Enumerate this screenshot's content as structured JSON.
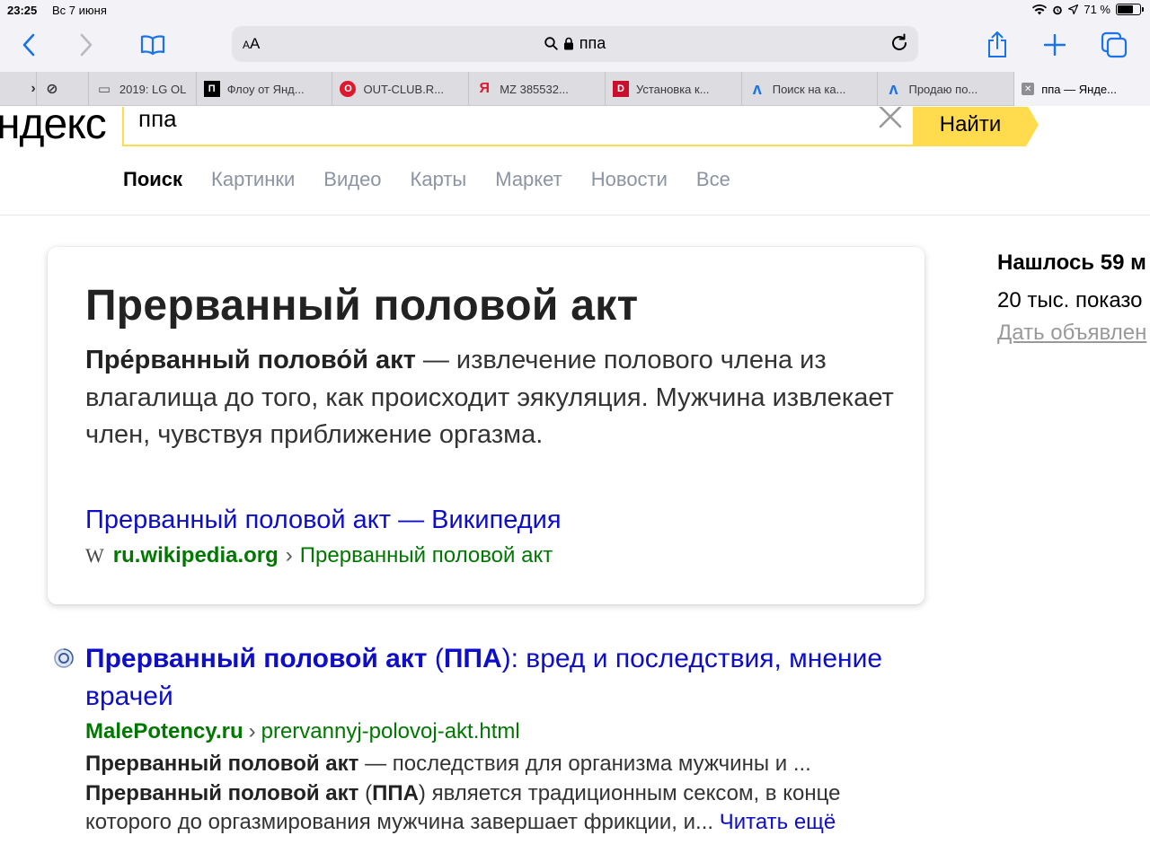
{
  "status": {
    "time": "23:25",
    "date": "Вс 7 июня",
    "battery": "71 %"
  },
  "toolbar": {
    "aa": "AA",
    "address": "ппа"
  },
  "tabs": [
    {
      "label": "",
      "fav": "›",
      "fav_color": "#333"
    },
    {
      "label": "",
      "fav": "⊘",
      "fav_color": "#333"
    },
    {
      "label": "2019: LG OL",
      "fav": "▭",
      "fav_color": "#555"
    },
    {
      "label": "Флоу от Янд...",
      "fav": "П",
      "fav_color": "#000"
    },
    {
      "label": "OUT-CLUB.R...",
      "fav": "O",
      "fav_color": "#e0182d"
    },
    {
      "label": "MZ 385532...",
      "fav": "Я",
      "fav_color": "#e0182d"
    },
    {
      "label": "Установка к...",
      "fav": "D",
      "fav_color": "#c8102e"
    },
    {
      "label": "Поиск на ка...",
      "fav": "ʌ",
      "fav_color": "#1a73e8"
    },
    {
      "label": "Продаю по...",
      "fav": "ʌ",
      "fav_color": "#1a73e8"
    },
    {
      "label": "ппа — Янде...",
      "fav": "✕",
      "fav_color": "#777"
    }
  ],
  "page": {
    "logo": "ндекс",
    "query": "ппа",
    "find_button": "Найти",
    "nav": [
      "Поиск",
      "Картинки",
      "Видео",
      "Карты",
      "Маркет",
      "Новости",
      "Все"
    ],
    "card": {
      "title": "Прерванный половой акт",
      "desc_bold": "Пре́рванный полово́й акт",
      "desc_rest": " — извлечение полового члена из влагалища до того, как происходит эякуляция. Мужчина извлекает член, чувствуя приближение оргазма.",
      "link": "Прерванный половой акт — Википедия",
      "url_domain": "ru.wikipedia.org",
      "url_sep": "›",
      "url_path": "Прерванный половой акт",
      "wiki_glyph": "W"
    },
    "result": {
      "title_bold": "Прерванный половой акт",
      "title_mid": " (",
      "title_bold2": "ППА",
      "title_rest": "): вред и последствия, мнение врачей",
      "url_domain": "MalePotency.ru",
      "url_sep": "›",
      "url_path": "prervannyj-polovoj-akt.html",
      "snip1_bold": "Прерванный половой акт",
      "snip1_rest": " — последствия для организма мужчины и ...",
      "snip2_bold": "Прерванный половой акт",
      "snip2_mid": " (",
      "snip2_bold2": "ППА",
      "snip2_rest": ") является традиционным сексом, в конце которого до оргазмирования мужчина завершает фрикции, и... ",
      "more": "Читать ещё"
    },
    "side": {
      "found": "Нашлось 59 м",
      "shows": "20 тыс. показо",
      "ad": "Дать объявлен"
    }
  }
}
